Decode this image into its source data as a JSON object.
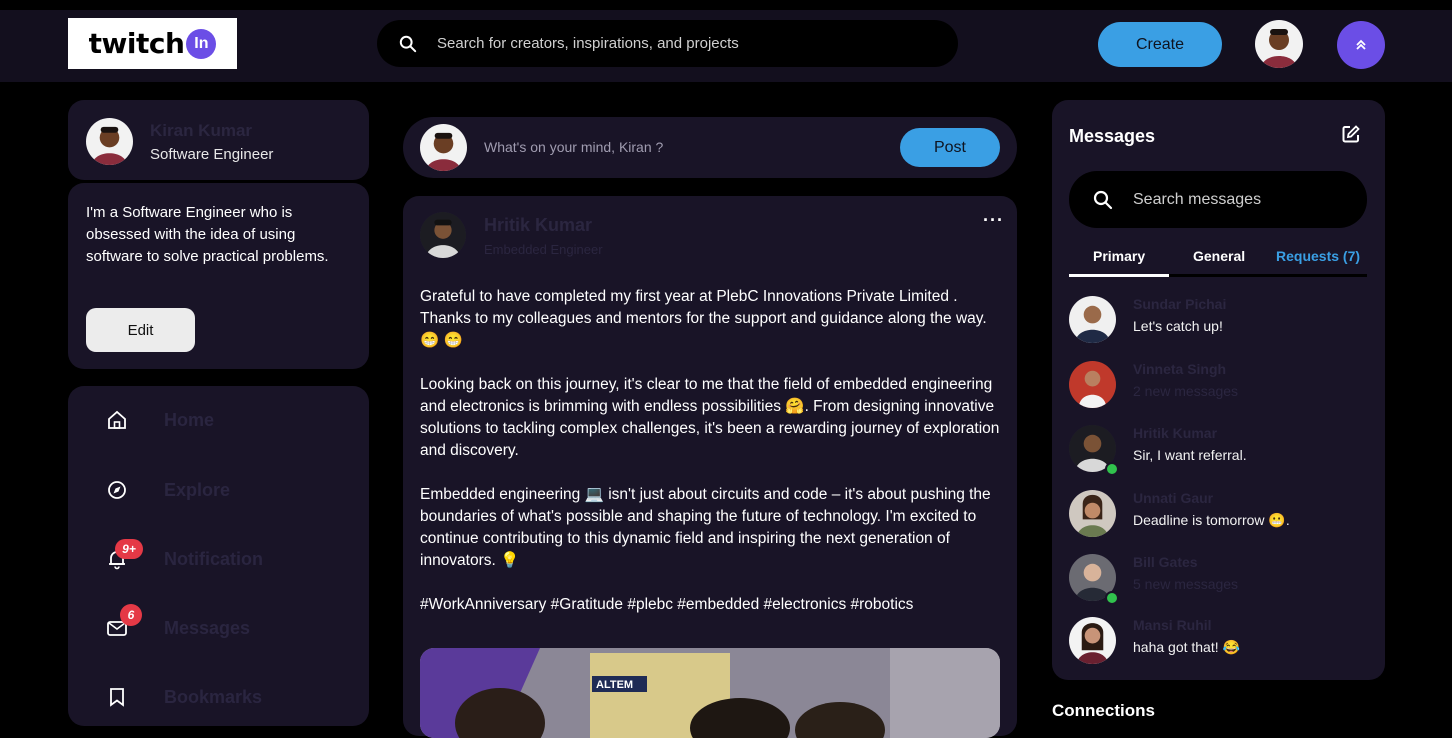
{
  "header": {
    "logo_text": "twitch",
    "logo_badge": "In",
    "search_placeholder": "Search for creators, inspirations, and projects",
    "create_label": "Create",
    "scroll_top_icon": "double-chevron-up-icon"
  },
  "profile": {
    "name": "Kiran Kumar",
    "role": "Software Engineer",
    "bio": "I'm a Software Engineer who is obsessed with the idea of using software to solve practical problems.",
    "edit_label": "Edit"
  },
  "nav": {
    "items": [
      {
        "label": "Home",
        "icon": "home-icon"
      },
      {
        "label": "Explore",
        "icon": "compass-icon"
      },
      {
        "label": "Notification",
        "icon": "bell-icon",
        "badge": "9+"
      },
      {
        "label": "Messages",
        "icon": "mail-icon",
        "badge": "6"
      },
      {
        "label": "Bookmarks",
        "icon": "bookmark-icon"
      }
    ]
  },
  "composer": {
    "placeholder": "What's on your mind, Kiran ?",
    "post_label": "Post"
  },
  "post": {
    "author": "Hritik Kumar",
    "role": "Embedded Engineer",
    "more": "···",
    "paragraphs": [
      "Grateful to have completed my first year at PlebC Innovations Private Limited . Thanks to my colleagues and mentors for the support and guidance along the way. 😁 😁",
      "Looking back on this journey, it's clear to me that the field of embedded engineering and electronics is brimming with endless possibilities 🤗. From designing innovative solutions to tackling complex challenges, it's been a rewarding journey of exploration and discovery.",
      "Embedded engineering 💻 isn't just about circuits and code – it's about pushing the boundaries of what's possible and shaping the future of technology. I'm excited to continue contributing to this dynamic field and inspiring the next generation of innovators. 💡",
      "#WorkAnniversary #Gratitude #plebc #embedded #electronics #robotics"
    ],
    "image_sign": "ALTEM"
  },
  "messages": {
    "title": "Messages",
    "search_placeholder": "Search messages",
    "tabs": [
      {
        "label": "Primary",
        "active": true
      },
      {
        "label": "General",
        "active": false
      },
      {
        "label": "Requests (7)",
        "active": false
      }
    ],
    "list": [
      {
        "name": "Sundar Pichai",
        "preview": "Let's catch up!",
        "dim": false,
        "online": false
      },
      {
        "name": "Vinneta Singh",
        "preview": "2 new messages",
        "dim": true,
        "online": false
      },
      {
        "name": "Hritik Kumar",
        "preview": "Sir, I want referral.",
        "dim": false,
        "online": true
      },
      {
        "name": "Unnati Gaur",
        "preview": "Deadline is tomorrow 😬.",
        "dim": false,
        "online": false
      },
      {
        "name": "Bill Gates",
        "preview": "5 new messages",
        "dim": true,
        "online": true
      },
      {
        "name": "Mansi Ruhil",
        "preview": "haha got that! 😂",
        "dim": false,
        "online": false
      }
    ]
  },
  "connections_title": "Connections",
  "colors": {
    "accent_blue": "#3a9fe4",
    "accent_purple": "#6b4ee6",
    "card_bg": "#191427",
    "badge_red": "#e53946",
    "online_green": "#31c24d"
  }
}
